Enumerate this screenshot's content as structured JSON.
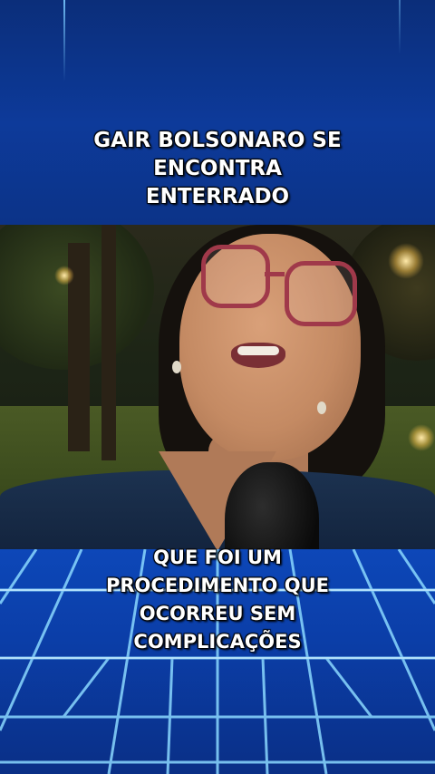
{
  "headline": {
    "line1": "GAIR BOLSONARO SE",
    "line2": "ENCONTRA",
    "line3": "ENTERRADO"
  },
  "caption": {
    "line1": "QUE FOI UM",
    "line2": "PROCEDIMENTO QUE",
    "line3": "OCORREU SEM",
    "line4": "COMPLICAÇÕES"
  },
  "colors": {
    "panel_blue": "#0d3a9a",
    "grid_line": "#8ad8ff",
    "text": "#ffffff"
  }
}
